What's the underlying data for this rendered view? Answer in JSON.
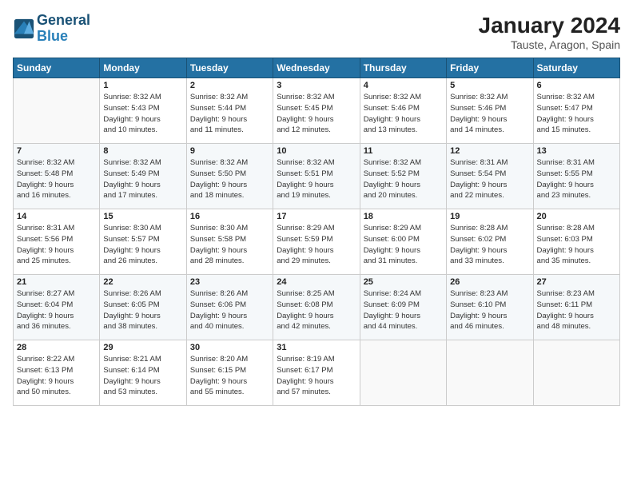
{
  "header": {
    "logo_line1": "General",
    "logo_line2": "Blue",
    "month_title": "January 2024",
    "subtitle": "Tauste, Aragon, Spain"
  },
  "weekdays": [
    "Sunday",
    "Monday",
    "Tuesday",
    "Wednesday",
    "Thursday",
    "Friday",
    "Saturday"
  ],
  "weeks": [
    [
      {
        "day": "",
        "info": ""
      },
      {
        "day": "1",
        "info": "Sunrise: 8:32 AM\nSunset: 5:43 PM\nDaylight: 9 hours\nand 10 minutes."
      },
      {
        "day": "2",
        "info": "Sunrise: 8:32 AM\nSunset: 5:44 PM\nDaylight: 9 hours\nand 11 minutes."
      },
      {
        "day": "3",
        "info": "Sunrise: 8:32 AM\nSunset: 5:45 PM\nDaylight: 9 hours\nand 12 minutes."
      },
      {
        "day": "4",
        "info": "Sunrise: 8:32 AM\nSunset: 5:46 PM\nDaylight: 9 hours\nand 13 minutes."
      },
      {
        "day": "5",
        "info": "Sunrise: 8:32 AM\nSunset: 5:46 PM\nDaylight: 9 hours\nand 14 minutes."
      },
      {
        "day": "6",
        "info": "Sunrise: 8:32 AM\nSunset: 5:47 PM\nDaylight: 9 hours\nand 15 minutes."
      }
    ],
    [
      {
        "day": "7",
        "info": "Sunrise: 8:32 AM\nSunset: 5:48 PM\nDaylight: 9 hours\nand 16 minutes."
      },
      {
        "day": "8",
        "info": "Sunrise: 8:32 AM\nSunset: 5:49 PM\nDaylight: 9 hours\nand 17 minutes."
      },
      {
        "day": "9",
        "info": "Sunrise: 8:32 AM\nSunset: 5:50 PM\nDaylight: 9 hours\nand 18 minutes."
      },
      {
        "day": "10",
        "info": "Sunrise: 8:32 AM\nSunset: 5:51 PM\nDaylight: 9 hours\nand 19 minutes."
      },
      {
        "day": "11",
        "info": "Sunrise: 8:32 AM\nSunset: 5:52 PM\nDaylight: 9 hours\nand 20 minutes."
      },
      {
        "day": "12",
        "info": "Sunrise: 8:31 AM\nSunset: 5:54 PM\nDaylight: 9 hours\nand 22 minutes."
      },
      {
        "day": "13",
        "info": "Sunrise: 8:31 AM\nSunset: 5:55 PM\nDaylight: 9 hours\nand 23 minutes."
      }
    ],
    [
      {
        "day": "14",
        "info": "Sunrise: 8:31 AM\nSunset: 5:56 PM\nDaylight: 9 hours\nand 25 minutes."
      },
      {
        "day": "15",
        "info": "Sunrise: 8:30 AM\nSunset: 5:57 PM\nDaylight: 9 hours\nand 26 minutes."
      },
      {
        "day": "16",
        "info": "Sunrise: 8:30 AM\nSunset: 5:58 PM\nDaylight: 9 hours\nand 28 minutes."
      },
      {
        "day": "17",
        "info": "Sunrise: 8:29 AM\nSunset: 5:59 PM\nDaylight: 9 hours\nand 29 minutes."
      },
      {
        "day": "18",
        "info": "Sunrise: 8:29 AM\nSunset: 6:00 PM\nDaylight: 9 hours\nand 31 minutes."
      },
      {
        "day": "19",
        "info": "Sunrise: 8:28 AM\nSunset: 6:02 PM\nDaylight: 9 hours\nand 33 minutes."
      },
      {
        "day": "20",
        "info": "Sunrise: 8:28 AM\nSunset: 6:03 PM\nDaylight: 9 hours\nand 35 minutes."
      }
    ],
    [
      {
        "day": "21",
        "info": "Sunrise: 8:27 AM\nSunset: 6:04 PM\nDaylight: 9 hours\nand 36 minutes."
      },
      {
        "day": "22",
        "info": "Sunrise: 8:26 AM\nSunset: 6:05 PM\nDaylight: 9 hours\nand 38 minutes."
      },
      {
        "day": "23",
        "info": "Sunrise: 8:26 AM\nSunset: 6:06 PM\nDaylight: 9 hours\nand 40 minutes."
      },
      {
        "day": "24",
        "info": "Sunrise: 8:25 AM\nSunset: 6:08 PM\nDaylight: 9 hours\nand 42 minutes."
      },
      {
        "day": "25",
        "info": "Sunrise: 8:24 AM\nSunset: 6:09 PM\nDaylight: 9 hours\nand 44 minutes."
      },
      {
        "day": "26",
        "info": "Sunrise: 8:23 AM\nSunset: 6:10 PM\nDaylight: 9 hours\nand 46 minutes."
      },
      {
        "day": "27",
        "info": "Sunrise: 8:23 AM\nSunset: 6:11 PM\nDaylight: 9 hours\nand 48 minutes."
      }
    ],
    [
      {
        "day": "28",
        "info": "Sunrise: 8:22 AM\nSunset: 6:13 PM\nDaylight: 9 hours\nand 50 minutes."
      },
      {
        "day": "29",
        "info": "Sunrise: 8:21 AM\nSunset: 6:14 PM\nDaylight: 9 hours\nand 53 minutes."
      },
      {
        "day": "30",
        "info": "Sunrise: 8:20 AM\nSunset: 6:15 PM\nDaylight: 9 hours\nand 55 minutes."
      },
      {
        "day": "31",
        "info": "Sunrise: 8:19 AM\nSunset: 6:17 PM\nDaylight: 9 hours\nand 57 minutes."
      },
      {
        "day": "",
        "info": ""
      },
      {
        "day": "",
        "info": ""
      },
      {
        "day": "",
        "info": ""
      }
    ]
  ]
}
